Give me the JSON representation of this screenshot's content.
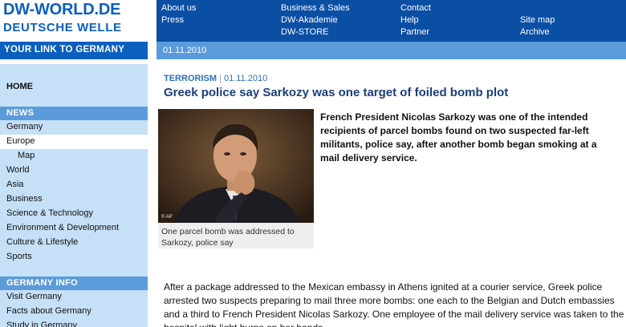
{
  "logo": {
    "line1": "DW-WORLD.DE",
    "line2": "DEUTSCHE WELLE"
  },
  "topnav": {
    "col1": [
      "About us",
      "Press"
    ],
    "col2": [
      "Business & Sales",
      "DW-Akademie",
      "DW-STORE"
    ],
    "col3": [
      "Contact",
      "Help",
      "Partner"
    ],
    "col4": [
      "Site map",
      "Archive"
    ]
  },
  "tagline": "YOUR LINK TO GERMANY",
  "strip_date": "01.11.2010",
  "sidebar": {
    "home": "HOME",
    "news_header": "NEWS",
    "news_items": [
      "Germany",
      "Europe",
      "Map",
      "World",
      "Asia",
      "Business",
      "Science & Technology",
      "Environment & Development",
      "Culture & Lifestyle",
      "Sports"
    ],
    "germany_header": "GERMANY INFO",
    "germany_items": [
      "Visit Germany",
      "Facts about Germany",
      "Study in Germany"
    ]
  },
  "article": {
    "category": "TERRORISM",
    "separator": "|",
    "date": "01.11.2010",
    "headline": "Greek police say Sarkozy was one target of foiled bomb plot",
    "photo_credit": "© AP",
    "caption": "One parcel bomb was addressed to Sarkozy, police say",
    "lead": "French President Nicolas Sarkozy was one of the intended recipients of parcel bombs found on two suspected far-left militants, police say, after another bomb began smoking at a mail delivery service.",
    "body": "After a package addressed to the Mexican embassy in Athens ignited at a courier service, Greek police arrested two suspects preparing to mail three more bombs: one each to the Belgian and Dutch embassies and a third to French President Nicolas Sarkozy. One employee of the mail delivery service was taken to the hospital with light burns on her hands."
  },
  "colors": {
    "brand_blue": "#0b5fbf",
    "nav_blue": "#0b4fa5",
    "light_blue": "#5b9bdc",
    "sidebar_bg": "#c6e0f7",
    "headline": "#1b3e7a"
  }
}
